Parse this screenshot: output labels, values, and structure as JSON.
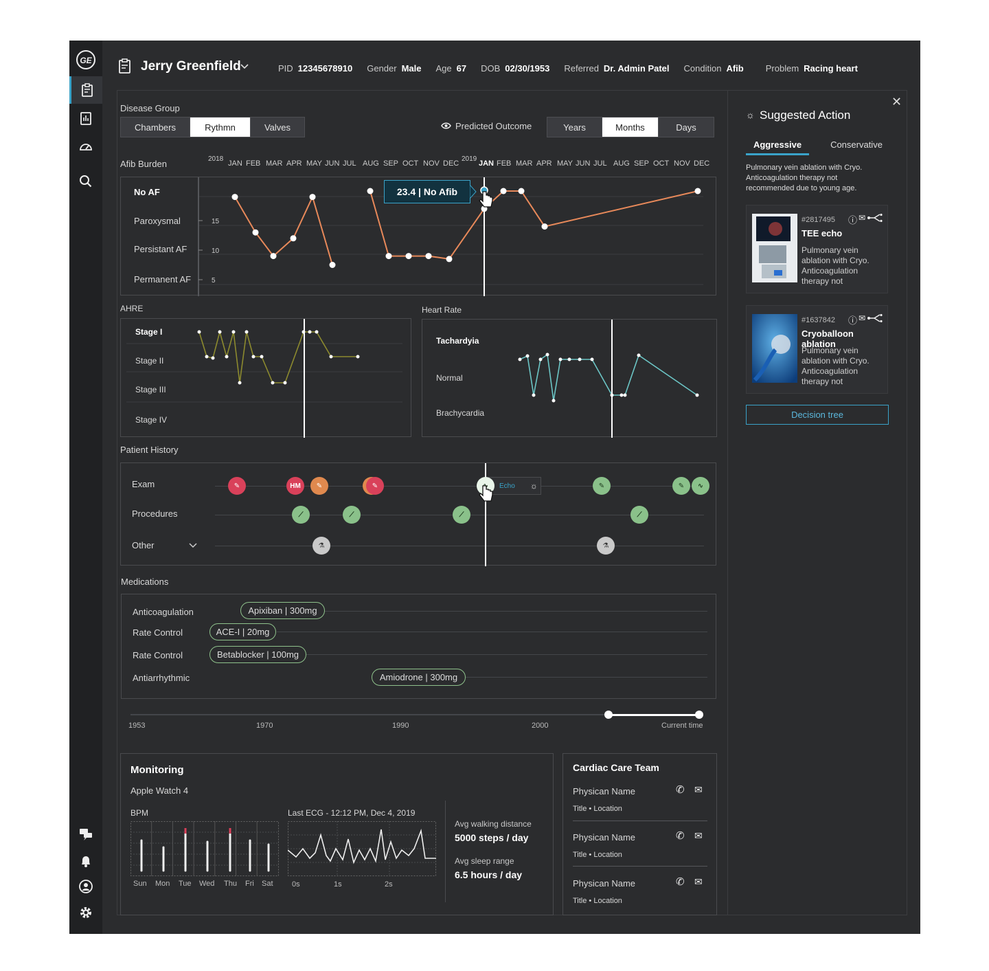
{
  "patient": {
    "name": "Jerry Greenfield",
    "fields": [
      {
        "k": "PID",
        "v": "12345678910"
      },
      {
        "k": "Gender",
        "v": "Male"
      },
      {
        "k": "Age",
        "v": "67"
      },
      {
        "k": "DOB",
        "v": "02/30/1953"
      },
      {
        "k": "Referred",
        "v": "Dr. Admin Patel"
      },
      {
        "k": "Condition",
        "v": "Afib"
      },
      {
        "k": "Problem",
        "v": "Racing heart"
      }
    ]
  },
  "disease_group": {
    "label": "Disease Group",
    "tabs": [
      "Chambers",
      "Rythmn",
      "Valves"
    ],
    "selected": "Rythmn"
  },
  "predicted_outcome": "Predicted Outcome",
  "time_scale": {
    "tabs": [
      "Years",
      "Months",
      "Days"
    ],
    "selected": "Months"
  },
  "afib": {
    "title": "Afib Burden",
    "year1": "2018",
    "year2": "2019",
    "months": [
      "JAN",
      "FEB",
      "MAR",
      "APR",
      "MAY",
      "JUN",
      "JUL",
      "AUG",
      "SEP",
      "OCT",
      "NOV",
      "DEC",
      "JAN",
      "FEB",
      "MAR",
      "APR",
      "MAY",
      "JUN",
      "JUL",
      "AUG",
      "SEP",
      "OCT",
      "NOV",
      "DEC"
    ],
    "rows": [
      "No AF",
      "Paroxysmal",
      "Persistant AF",
      "Permanent AF"
    ],
    "ticks": [
      "15",
      "10",
      "5"
    ],
    "tooltip": "23.4 | No Afib"
  },
  "ahre": {
    "title": "AHRE",
    "rows": [
      "Stage I",
      "Stage II",
      "Stage III",
      "Stage IV"
    ]
  },
  "heart_rate": {
    "title": "Heart Rate",
    "rows": [
      "Tachardyia",
      "Normal",
      "Brachycardia"
    ]
  },
  "chart_data": [
    {
      "type": "line",
      "title": "Afib Burden",
      "series": [
        {
          "values": [
            19,
            13,
            9,
            12,
            19,
            7.5,
            20,
            9,
            9,
            9,
            8.5,
            17,
            23.4,
            20,
            20,
            14,
            20
          ]
        }
      ],
      "yticks": [
        5,
        10,
        15
      ],
      "categories_axis": "month"
    },
    {
      "type": "line",
      "title": "AHRE",
      "series": [
        {
          "values": [
            "Stage I",
            "Stage II",
            "Stage II",
            "Stage I",
            "Stage II",
            "Stage I",
            "Stage III",
            "Stage I",
            "Stage II",
            "Stage II",
            "Stage III",
            "Stage III",
            "Stage I",
            "Stage I",
            "Stage I",
            "Stage II",
            "Stage II"
          ]
        }
      ]
    },
    {
      "type": "line",
      "title": "Heart Rate",
      "series": [
        {
          "values": [
            "Tachardyia",
            "Tachardyia",
            "Normal",
            "Tachardyia",
            "Tachardyia",
            "Normal",
            "Tachardyia",
            "Tachardyia",
            "Tachardyia",
            "Tachardyia",
            "Tachardyia",
            "Normal",
            "Normal",
            "Normal",
            "Tachardyia",
            "Normal"
          ]
        }
      ]
    }
  ],
  "history": {
    "title": "Patient History",
    "rows": [
      "Exam",
      "Procedures",
      "Other"
    ],
    "exam_badge": "HM",
    "echo_label": "Echo"
  },
  "medications": {
    "title": "Medications",
    "rows": [
      {
        "label": "Anticoagulation",
        "pill": "Apixiban | 300mg"
      },
      {
        "label": "Rate Control",
        "pill": "ACE-I | 20mg"
      },
      {
        "label": "Rate Control",
        "pill": "Betablocker | 100mg"
      },
      {
        "label": "Antiarrhythmic",
        "pill": "Amiodrone | 300mg"
      }
    ]
  },
  "timeline": {
    "ticks": [
      "1953",
      "1970",
      "1990",
      "2000",
      "Current time"
    ],
    "range_start_fraction": 0.84
  },
  "monitoring": {
    "title": "Monitoring",
    "device": "Apple Watch 4",
    "bpm_label": "BPM",
    "days": [
      "Sun",
      "Mon",
      "Tue",
      "Wed",
      "Thu",
      "Fri",
      "Sat"
    ],
    "ecg_label": "Last ECG - 12:12 PM, Dec 4, 2019",
    "ecg_ticks": [
      "0s",
      "1s",
      "2s"
    ],
    "walk_label": "Avg walking distance",
    "walk_value": "5000 steps / day",
    "sleep_label": "Avg sleep range",
    "sleep_value": "6.5 hours / day"
  },
  "care_team": {
    "title": "Cardiac Care Team",
    "members": [
      {
        "name": "Physican Name",
        "sub": "Title • Location"
      },
      {
        "name": "Physican Name",
        "sub": "Title • Location"
      },
      {
        "name": "Physican Name",
        "sub": "Title • Location"
      }
    ]
  },
  "suggested": {
    "title": "Suggested Action",
    "tabs": [
      "Aggressive",
      "Conservative"
    ],
    "selected": "Aggressive",
    "summary": "Pulmonary vein ablation with Cryo. Anticoagulation therapy not recommended due to young age.",
    "cards": [
      {
        "id": "#2817495",
        "title": "TEE echo",
        "desc": "Pulmonary vein ablation with Cryo. Anticoagulation therapy not"
      },
      {
        "id": "#1637842",
        "title": "Cryoballoon ablation",
        "desc": "Pulmonary vein ablation with Cryo. Anticoagulation therapy not"
      }
    ],
    "decision_tree": "Decision tree"
  },
  "colors": {
    "afib": "#e8895a",
    "ahre": "#8c8a2e",
    "heart_rate": "#6cc6c6",
    "accent": "#3aa3c9",
    "ok": "#8ac18a",
    "alert": "#d9415a"
  }
}
